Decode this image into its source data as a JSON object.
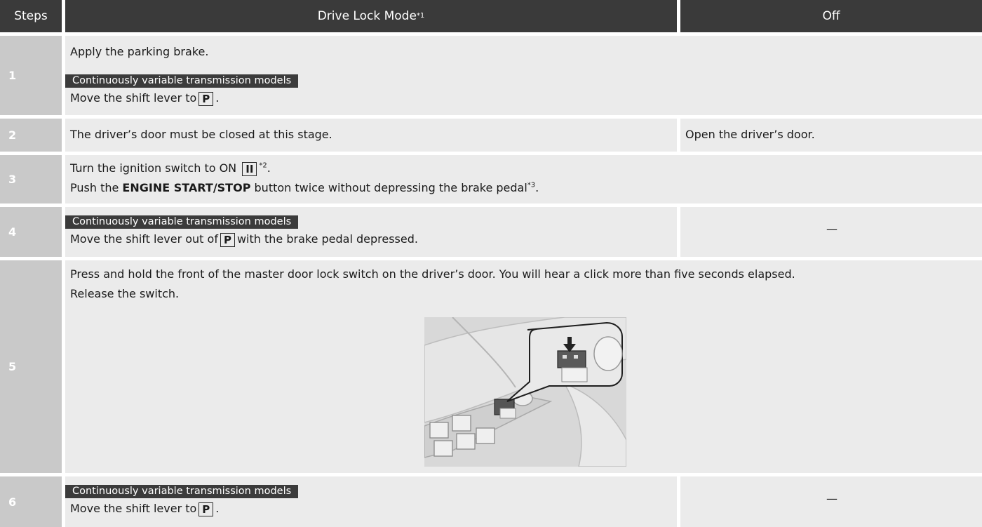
{
  "header": {
    "steps": "Steps",
    "drive_lock_mode": "Drive Lock Mode",
    "drive_lock_mode_note": "*1",
    "off": "Off"
  },
  "rows": [
    {
      "number": "1",
      "line1": "Apply the parking brake.",
      "tag": "Continuously variable transmission models",
      "line2": "Move the shift lever to",
      "key": "P",
      "end": "."
    },
    {
      "number": "2",
      "text": "The driver’s door must be closed at this stage.",
      "off_text": "Open the driver’s door."
    },
    {
      "number": "3",
      "line1": "Turn the ignition switch to ON",
      "key": "II",
      "note1": "*2",
      "end1": ".",
      "line2_pre": "Push the",
      "line2_bold": "ENGINE START/STOP",
      "line2_post": "button twice without depressing the brake pedal",
      "note2": "*3",
      "end2": "."
    },
    {
      "number": "4",
      "tag": "Continuously variable transmission models",
      "line_pre": "Move the shift lever out of",
      "key": "P",
      "line_post": "with the brake pedal depressed.",
      "off_text": "—"
    },
    {
      "number": "5",
      "line1": "Press and hold the front of the master door lock switch on the driver’s door. You will hear a click more than five seconds elapsed.",
      "line2": "Release the switch."
    },
    {
      "number": "6",
      "tag": "Continuously variable transmission models",
      "line_pre": "Move the shift lever to",
      "key": "P",
      "end": ".",
      "off_text": "—"
    }
  ]
}
